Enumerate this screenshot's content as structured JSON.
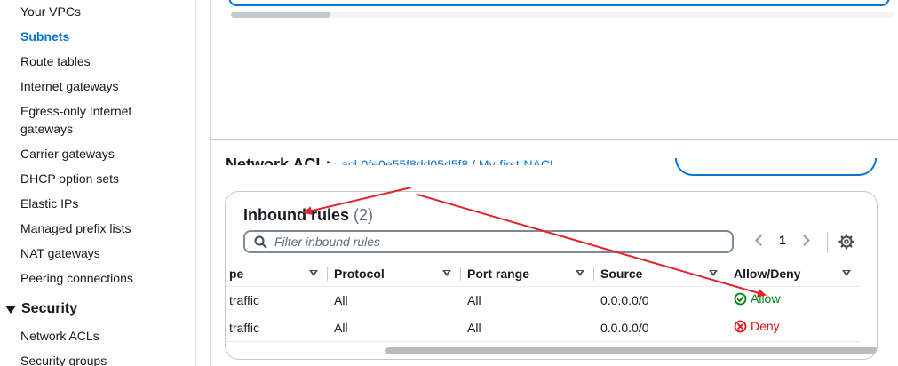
{
  "sidebar": {
    "items": [
      {
        "label": "Your VPCs",
        "active": false
      },
      {
        "label": "Subnets",
        "active": true
      },
      {
        "label": "Route tables",
        "active": false
      },
      {
        "label": "Internet gateways",
        "active": false
      },
      {
        "label": "Egress-only Internet",
        "active": false
      },
      {
        "label": "gateways",
        "active": false
      },
      {
        "label": "Carrier gateways",
        "active": false
      },
      {
        "label": "DHCP option sets",
        "active": false
      },
      {
        "label": "Elastic IPs",
        "active": false
      },
      {
        "label": "Managed prefix lists",
        "active": false
      },
      {
        "label": "NAT gateways",
        "active": false
      },
      {
        "label": "Peering connections",
        "active": false
      }
    ],
    "section": {
      "title": "Security",
      "items": [
        {
          "label": "Network ACLs"
        },
        {
          "label": "Security groups"
        }
      ]
    }
  },
  "bottom": {
    "partial_heading": "Network ACL:",
    "partial_link": "acl-0fe0e55f8dd05d5f8 / My-first-NACL",
    "rules": {
      "title": "Inbound rules",
      "count": "(2)",
      "filter_placeholder": "Filter inbound rules",
      "page": "1",
      "columns": [
        "pe",
        "Protocol",
        "Port range",
        "Source",
        "Allow/Deny"
      ],
      "rows": [
        {
          "type": "traffic",
          "protocol": "All",
          "port_range": "All",
          "source": "0.0.0.0/0",
          "action": "Allow"
        },
        {
          "type": "traffic",
          "protocol": "All",
          "port_range": "All",
          "source": "0.0.0.0/0",
          "action": "Deny"
        }
      ]
    }
  },
  "colors": {
    "accent": "#0972d3",
    "allow": "#037f0c",
    "deny": "#d91515",
    "annotation": "#e0262b"
  },
  "icons": [
    "search-icon",
    "chevron-left-icon",
    "chevron-right-icon",
    "gear-icon",
    "sort-icon",
    "check-circle-icon",
    "x-circle-icon",
    "drag-handle-icon",
    "panel-bottom-icon",
    "panel-split-icon",
    "panel-full-icon"
  ]
}
